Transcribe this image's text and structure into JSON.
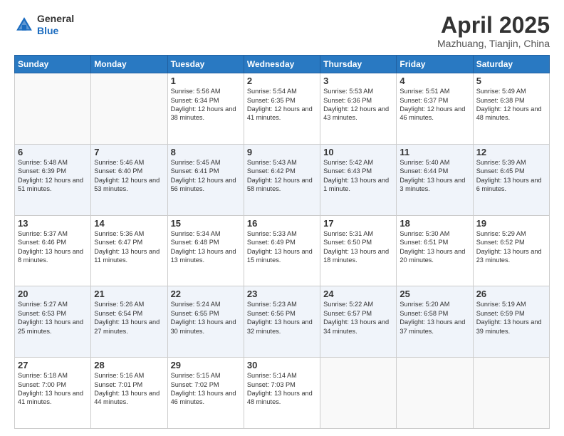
{
  "header": {
    "logo_general": "General",
    "logo_blue": "Blue",
    "title": "April 2025",
    "location": "Mazhuang, Tianjin, China"
  },
  "days_of_week": [
    "Sunday",
    "Monday",
    "Tuesday",
    "Wednesday",
    "Thursday",
    "Friday",
    "Saturday"
  ],
  "weeks": [
    [
      {
        "day": "",
        "text": ""
      },
      {
        "day": "",
        "text": ""
      },
      {
        "day": "1",
        "text": "Sunrise: 5:56 AM\nSunset: 6:34 PM\nDaylight: 12 hours and 38 minutes."
      },
      {
        "day": "2",
        "text": "Sunrise: 5:54 AM\nSunset: 6:35 PM\nDaylight: 12 hours and 41 minutes."
      },
      {
        "day": "3",
        "text": "Sunrise: 5:53 AM\nSunset: 6:36 PM\nDaylight: 12 hours and 43 minutes."
      },
      {
        "day": "4",
        "text": "Sunrise: 5:51 AM\nSunset: 6:37 PM\nDaylight: 12 hours and 46 minutes."
      },
      {
        "day": "5",
        "text": "Sunrise: 5:49 AM\nSunset: 6:38 PM\nDaylight: 12 hours and 48 minutes."
      }
    ],
    [
      {
        "day": "6",
        "text": "Sunrise: 5:48 AM\nSunset: 6:39 PM\nDaylight: 12 hours and 51 minutes."
      },
      {
        "day": "7",
        "text": "Sunrise: 5:46 AM\nSunset: 6:40 PM\nDaylight: 12 hours and 53 minutes."
      },
      {
        "day": "8",
        "text": "Sunrise: 5:45 AM\nSunset: 6:41 PM\nDaylight: 12 hours and 56 minutes."
      },
      {
        "day": "9",
        "text": "Sunrise: 5:43 AM\nSunset: 6:42 PM\nDaylight: 12 hours and 58 minutes."
      },
      {
        "day": "10",
        "text": "Sunrise: 5:42 AM\nSunset: 6:43 PM\nDaylight: 13 hours and 1 minute."
      },
      {
        "day": "11",
        "text": "Sunrise: 5:40 AM\nSunset: 6:44 PM\nDaylight: 13 hours and 3 minutes."
      },
      {
        "day": "12",
        "text": "Sunrise: 5:39 AM\nSunset: 6:45 PM\nDaylight: 13 hours and 6 minutes."
      }
    ],
    [
      {
        "day": "13",
        "text": "Sunrise: 5:37 AM\nSunset: 6:46 PM\nDaylight: 13 hours and 8 minutes."
      },
      {
        "day": "14",
        "text": "Sunrise: 5:36 AM\nSunset: 6:47 PM\nDaylight: 13 hours and 11 minutes."
      },
      {
        "day": "15",
        "text": "Sunrise: 5:34 AM\nSunset: 6:48 PM\nDaylight: 13 hours and 13 minutes."
      },
      {
        "day": "16",
        "text": "Sunrise: 5:33 AM\nSunset: 6:49 PM\nDaylight: 13 hours and 15 minutes."
      },
      {
        "day": "17",
        "text": "Sunrise: 5:31 AM\nSunset: 6:50 PM\nDaylight: 13 hours and 18 minutes."
      },
      {
        "day": "18",
        "text": "Sunrise: 5:30 AM\nSunset: 6:51 PM\nDaylight: 13 hours and 20 minutes."
      },
      {
        "day": "19",
        "text": "Sunrise: 5:29 AM\nSunset: 6:52 PM\nDaylight: 13 hours and 23 minutes."
      }
    ],
    [
      {
        "day": "20",
        "text": "Sunrise: 5:27 AM\nSunset: 6:53 PM\nDaylight: 13 hours and 25 minutes."
      },
      {
        "day": "21",
        "text": "Sunrise: 5:26 AM\nSunset: 6:54 PM\nDaylight: 13 hours and 27 minutes."
      },
      {
        "day": "22",
        "text": "Sunrise: 5:24 AM\nSunset: 6:55 PM\nDaylight: 13 hours and 30 minutes."
      },
      {
        "day": "23",
        "text": "Sunrise: 5:23 AM\nSunset: 6:56 PM\nDaylight: 13 hours and 32 minutes."
      },
      {
        "day": "24",
        "text": "Sunrise: 5:22 AM\nSunset: 6:57 PM\nDaylight: 13 hours and 34 minutes."
      },
      {
        "day": "25",
        "text": "Sunrise: 5:20 AM\nSunset: 6:58 PM\nDaylight: 13 hours and 37 minutes."
      },
      {
        "day": "26",
        "text": "Sunrise: 5:19 AM\nSunset: 6:59 PM\nDaylight: 13 hours and 39 minutes."
      }
    ],
    [
      {
        "day": "27",
        "text": "Sunrise: 5:18 AM\nSunset: 7:00 PM\nDaylight: 13 hours and 41 minutes."
      },
      {
        "day": "28",
        "text": "Sunrise: 5:16 AM\nSunset: 7:01 PM\nDaylight: 13 hours and 44 minutes."
      },
      {
        "day": "29",
        "text": "Sunrise: 5:15 AM\nSunset: 7:02 PM\nDaylight: 13 hours and 46 minutes."
      },
      {
        "day": "30",
        "text": "Sunrise: 5:14 AM\nSunset: 7:03 PM\nDaylight: 13 hours and 48 minutes."
      },
      {
        "day": "",
        "text": ""
      },
      {
        "day": "",
        "text": ""
      },
      {
        "day": "",
        "text": ""
      }
    ]
  ]
}
